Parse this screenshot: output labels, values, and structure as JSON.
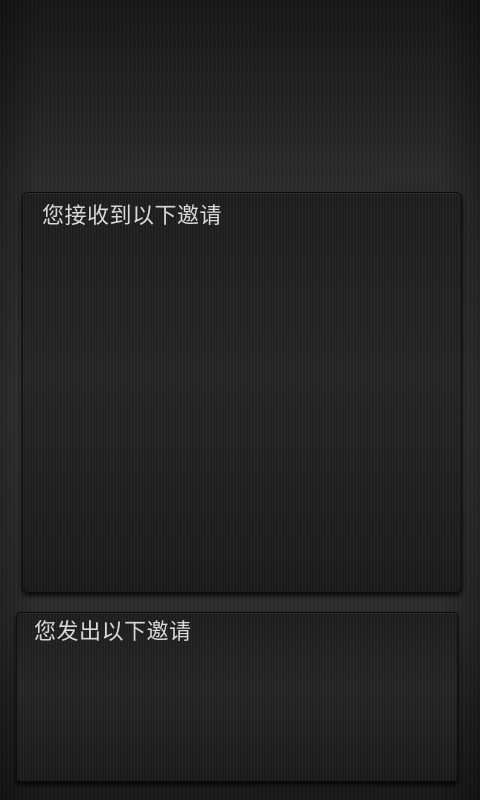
{
  "received_invitations": {
    "title": "您接收到以下邀请",
    "items": []
  },
  "sent_invitations": {
    "title": "您发出以下邀请",
    "items": []
  }
}
